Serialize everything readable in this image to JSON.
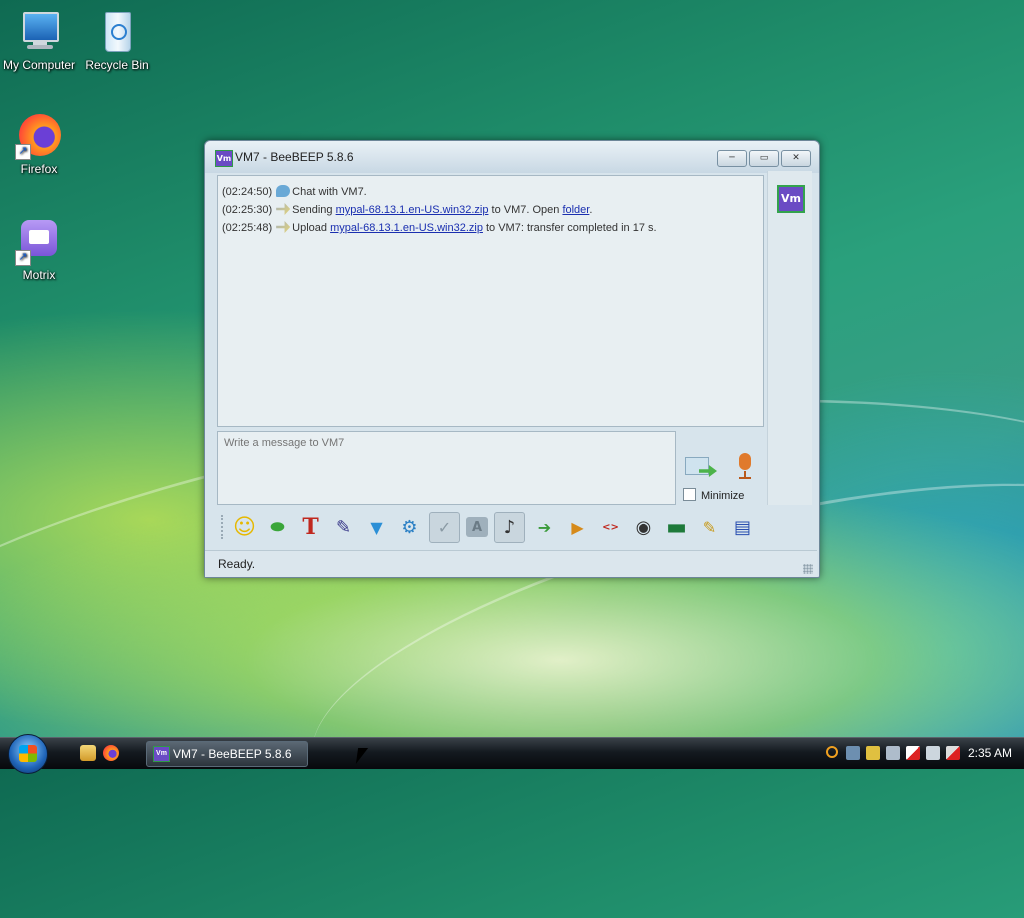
{
  "desktop": {
    "icons": [
      {
        "label": "My Computer",
        "icon": "computer-icon"
      },
      {
        "label": "Recycle Bin",
        "icon": "recycle-bin-icon"
      },
      {
        "label": "Firefox",
        "icon": "firefox-icon"
      },
      {
        "label": "Motrix",
        "icon": "motrix-icon"
      }
    ]
  },
  "window": {
    "title": "VM7 - BeeBEEP 5.8.6",
    "app_icon_text": "Vm",
    "controls": {
      "minimize": "─",
      "maximize": "▭",
      "close": "✕"
    },
    "messages": [
      {
        "time": "(02:24:50)",
        "text": "Chat with VM7."
      },
      {
        "time": "(02:25:30)",
        "pre": "Sending ",
        "file": "mypal-68.13.1.en-US.win32.zip",
        "mid": " to VM7. Open ",
        "link2": "folder",
        "post": "."
      },
      {
        "time": "(02:25:48)",
        "pre": "Upload ",
        "file": "mypal-68.13.1.en-US.win32.zip",
        "post": " to VM7: transfer completed in 17 s."
      }
    ],
    "avatar_text": "Vm",
    "input_placeholder": "Write a message to VM7",
    "minimize_label": "Minimize",
    "status": "Ready.",
    "toolbar": [
      {
        "name": "emoticons-icon",
        "glyph": "☺",
        "color": "#e6b800"
      },
      {
        "name": "bee-icon",
        "glyph": "⬬",
        "color": "#3aa63a"
      },
      {
        "name": "font-icon",
        "glyph": "T",
        "color": "#c0281e"
      },
      {
        "name": "font-color-icon",
        "glyph": "✎",
        "color": "#3a3a8a"
      },
      {
        "name": "filter-icon",
        "glyph": "▼",
        "color": "#2b8fd6"
      },
      {
        "name": "settings-icon",
        "glyph": "⚙",
        "color": "#2a7fc4"
      },
      {
        "name": "spellcheck-icon",
        "glyph": "✓",
        "color": "#8a9aa4"
      },
      {
        "name": "word-complete-icon",
        "glyph": "A",
        "color": "#6b7b86"
      },
      {
        "name": "sound-icon",
        "glyph": "♪",
        "color": "#333333"
      },
      {
        "name": "send-file-icon",
        "glyph": "➔",
        "color": "#3a9a3a"
      },
      {
        "name": "send-folder-icon",
        "glyph": "▶",
        "color": "#d68a1a"
      },
      {
        "name": "html-icon",
        "glyph": "<>",
        "color": "#c0281e"
      },
      {
        "name": "screenshot-icon",
        "glyph": "◉",
        "color": "#333333"
      },
      {
        "name": "terminal-icon",
        "glyph": "▬",
        "color": "#1e7a3a"
      },
      {
        "name": "notes-icon",
        "glyph": "✎",
        "color": "#c89a1a"
      },
      {
        "name": "save-icon",
        "glyph": "▤",
        "color": "#2a4fb0"
      }
    ]
  },
  "taskbar": {
    "task_label": "VM7 - BeeBEEP 5.8.6",
    "task_icon_text": "Vm",
    "clock": "2:35 AM"
  }
}
